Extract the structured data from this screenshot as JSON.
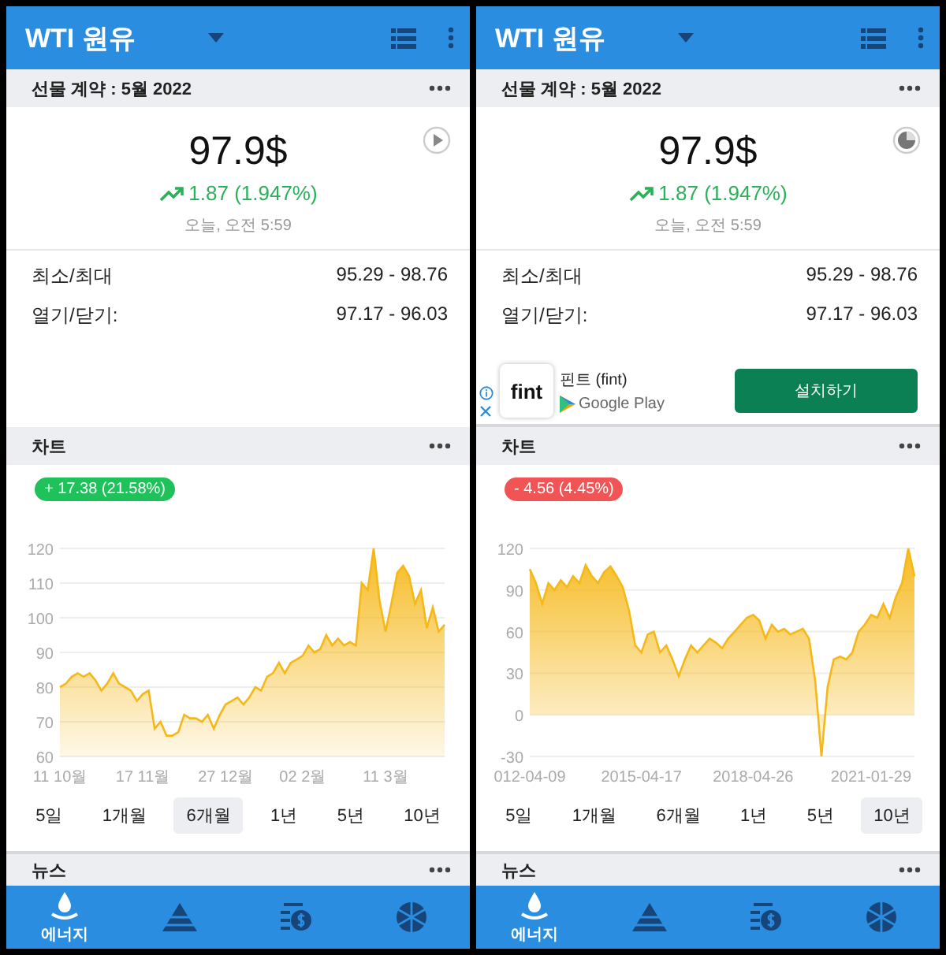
{
  "panels": [
    {
      "app_bar": {
        "title": "WTI 원유"
      },
      "contract_header": {
        "title": "선물 계약 : 5월 2022"
      },
      "quote": {
        "price": "97.9$",
        "change": "1.87 (1.947%)",
        "time": "오늘, 오전 5:59",
        "loading": false
      },
      "stats": [
        {
          "label": "최소/최대",
          "value": "95.29 - 98.76"
        },
        {
          "label": "열기/닫기:",
          "value": "97.17 - 96.03"
        }
      ],
      "chart_section": {
        "title": "차트",
        "change_badge": {
          "text": "+ 17.38 (21.58%)",
          "color": "#1fc15b"
        },
        "chart_data": {
          "type": "area",
          "grid": true,
          "ylim": [
            60,
            120
          ],
          "yticks": [
            60,
            70,
            80,
            90,
            100,
            110,
            120
          ],
          "categories": [
            "11 10월",
            null,
            null,
            null,
            null,
            null,
            null,
            null,
            null,
            null,
            null,
            null,
            null,
            null,
            "17 11월",
            null,
            null,
            null,
            null,
            null,
            null,
            null,
            null,
            null,
            null,
            null,
            null,
            null,
            "27 12월",
            null,
            null,
            null,
            null,
            null,
            null,
            null,
            null,
            null,
            null,
            null,
            null,
            "02 2월",
            null,
            null,
            null,
            null,
            null,
            null,
            null,
            null,
            null,
            null,
            null,
            null,
            null,
            "11 3월",
            null,
            null,
            null,
            null,
            null,
            null,
            null,
            null,
            null,
            null
          ],
          "series": [
            {
              "color": "#f6b818",
              "values": [
                80,
                81,
                83,
                84,
                83,
                84,
                82,
                79,
                81,
                84,
                81,
                80,
                79,
                76,
                78,
                79,
                68,
                70,
                66,
                66,
                67,
                72,
                71,
                71,
                70,
                72,
                68,
                72,
                75,
                76,
                77,
                75,
                77,
                80,
                79,
                83,
                84,
                87,
                84,
                87,
                88,
                89,
                92,
                90,
                91,
                95,
                92,
                94,
                92,
                93,
                92,
                110,
                108,
                120,
                105,
                96,
                104,
                113,
                115,
                112,
                104,
                108,
                97,
                103,
                96,
                98
              ]
            }
          ]
        },
        "ranges": [
          {
            "label": "5일",
            "selected": false
          },
          {
            "label": "1개월",
            "selected": false
          },
          {
            "label": "6개월",
            "selected": true
          },
          {
            "label": "1년",
            "selected": false
          },
          {
            "label": "5년",
            "selected": false
          },
          {
            "label": "10년",
            "selected": false
          }
        ]
      },
      "news_header": {
        "title": "뉴스"
      },
      "bottom_nav": [
        {
          "kind": "energy",
          "label": "에너지",
          "selected": true
        },
        {
          "kind": "pyramid",
          "selected": false
        },
        {
          "kind": "money",
          "selected": false
        },
        {
          "kind": "wheel",
          "selected": false
        }
      ]
    },
    {
      "app_bar": {
        "title": "WTI 원유"
      },
      "contract_header": {
        "title": "선물 계약 : 5월 2022"
      },
      "quote": {
        "price": "97.9$",
        "change": "1.87 (1.947%)",
        "time": "오늘, 오전 5:59",
        "loading": true
      },
      "stats": [
        {
          "label": "최소/최대",
          "value": "95.29 - 98.76"
        },
        {
          "label": "열기/닫기:",
          "value": "97.17 - 96.03"
        }
      ],
      "ad": {
        "logo_text": "fint",
        "app_name": "핀트 (fint)",
        "store": "Google Play",
        "button": "설치하기"
      },
      "chart_section": {
        "title": "차트",
        "change_badge": {
          "text": "- 4.56 (4.45%)",
          "color": "#f05454"
        },
        "chart_data": {
          "type": "area",
          "grid": true,
          "ylim": [
            -30,
            120
          ],
          "yticks": [
            -30,
            0,
            30,
            60,
            90,
            120
          ],
          "categories": [
            "012-04-09",
            null,
            null,
            null,
            null,
            null,
            null,
            null,
            null,
            null,
            null,
            null,
            null,
            null,
            null,
            null,
            null,
            null,
            "2015-04-17",
            null,
            null,
            null,
            null,
            null,
            null,
            null,
            null,
            null,
            null,
            null,
            null,
            null,
            null,
            null,
            null,
            null,
            "2018-04-26",
            null,
            null,
            null,
            null,
            null,
            null,
            null,
            null,
            null,
            null,
            null,
            null,
            null,
            null,
            null,
            null,
            null,
            null,
            "2021-01-29",
            null,
            null,
            null,
            null,
            null,
            null,
            null
          ],
          "series": [
            {
              "color": "#f6b818",
              "values": [
                105,
                95,
                80,
                95,
                90,
                97,
                92,
                100,
                95,
                108,
                100,
                95,
                103,
                107,
                100,
                92,
                75,
                50,
                45,
                58,
                60,
                45,
                50,
                40,
                28,
                40,
                50,
                45,
                50,
                55,
                52,
                48,
                55,
                60,
                65,
                70,
                72,
                68,
                55,
                65,
                60,
                62,
                58,
                60,
                62,
                55,
                25,
                -30,
                20,
                40,
                42,
                40,
                45,
                60,
                65,
                72,
                70,
                80,
                70,
                85,
                95,
                120,
                100
              ]
            }
          ]
        },
        "ranges": [
          {
            "label": "5일",
            "selected": false
          },
          {
            "label": "1개월",
            "selected": false
          },
          {
            "label": "6개월",
            "selected": false
          },
          {
            "label": "1년",
            "selected": false
          },
          {
            "label": "5년",
            "selected": false
          },
          {
            "label": "10년",
            "selected": true
          }
        ]
      },
      "news_header": {
        "title": "뉴스"
      },
      "bottom_nav": [
        {
          "kind": "energy",
          "label": "에너지",
          "selected": true
        },
        {
          "kind": "pyramid",
          "selected": false
        },
        {
          "kind": "money",
          "selected": false
        },
        {
          "kind": "wheel",
          "selected": false
        }
      ]
    }
  ]
}
